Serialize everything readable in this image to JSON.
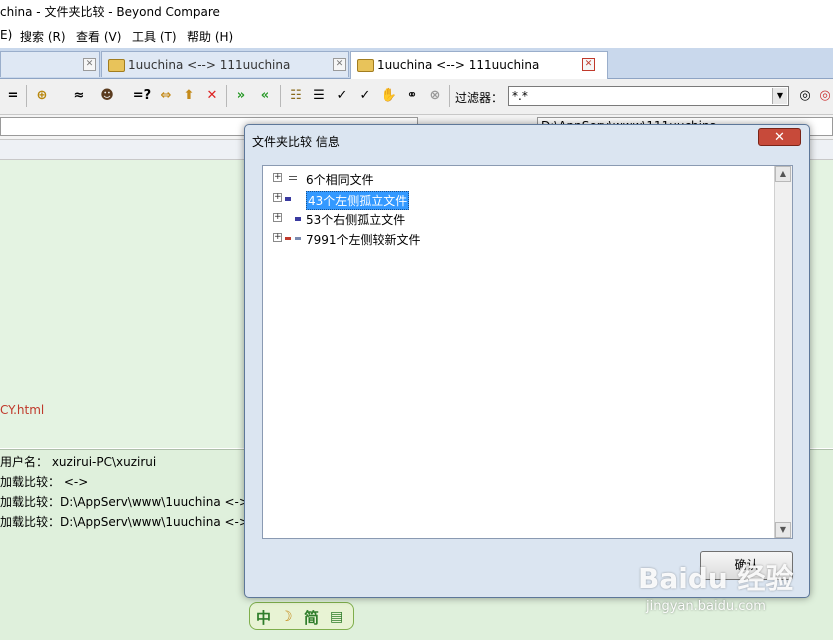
{
  "window": {
    "title": "china - 文件夹比较 - Beyond Compare"
  },
  "menu": {
    "items": [
      {
        "label": "E)"
      },
      {
        "label": "搜索 (R)"
      },
      {
        "label": "查看 (V)"
      },
      {
        "label": "工具 (T)"
      },
      {
        "label": "帮助 (H)"
      }
    ]
  },
  "tabs": [
    {
      "label": "1uuchina <--> 111uuchina",
      "active": false
    },
    {
      "label": "1uuchina <--> 111uuchina",
      "active": true
    }
  ],
  "toolbar": {
    "filter_label": "过滤器：",
    "filter_value": "*.*",
    "button_glyphs": [
      "=",
      "⊕",
      "≈",
      "=?",
      "⇔",
      "✕",
      "»",
      "«",
      "✓",
      "✓"
    ]
  },
  "paths": {
    "right": "D:\\AppServ\\www\\111uuchina"
  },
  "main": {
    "orphan_file": "CY.html"
  },
  "log": {
    "lines": [
      "用户名： xuzirui-PC\\xuzirui",
      "加载比较： <->",
      "加载比较：D:\\AppServ\\www\\1uuchina <->",
      "加载比较：D:\\AppServ\\www\\1uuchina <->"
    ]
  },
  "dialog": {
    "title": "文件夹比较 信息",
    "close_label": "✕",
    "ok_label": "确认",
    "tree": [
      {
        "label": "6个相同文件",
        "marker_color": "#555555",
        "selected": false
      },
      {
        "label": "43个左侧孤立文件",
        "marker_color": "#3a3aa0",
        "selected": true
      },
      {
        "label": "53个右侧孤立文件",
        "marker_color": "#3a3aa0",
        "selected": false
      },
      {
        "label": "7991个左侧较新文件",
        "marker_color": "#c0392b",
        "selected": false
      }
    ]
  },
  "ime": {
    "left": "中",
    "right": "简"
  },
  "watermark": {
    "logo": "Baidu 经验",
    "url": "jingyan.baidu.com"
  },
  "colors": {
    "pane_green": "#e4f3e2",
    "selection_blue": "#3399ff",
    "dialog_bg": "#dbe5f1"
  }
}
